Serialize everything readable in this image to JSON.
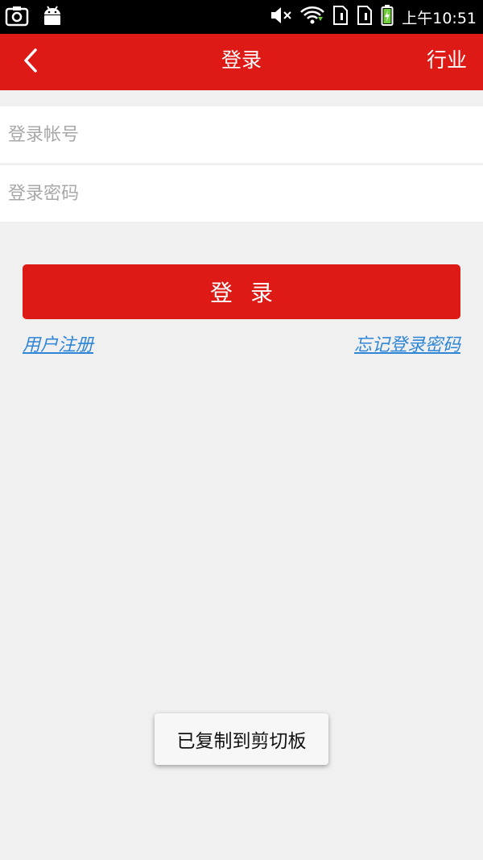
{
  "status_bar": {
    "time": "上午10:51",
    "left_icons": [
      "screenshot-icon",
      "android-icon"
    ],
    "right_icons": [
      "mute-icon",
      "wifi-icon",
      "sim1-icon",
      "sim2-icon",
      "battery-charging-icon"
    ]
  },
  "header": {
    "title": "登录",
    "action_label": "行业",
    "back_icon": "back-arrow-icon"
  },
  "form": {
    "account_placeholder": "登录帐号",
    "account_value": "",
    "password_placeholder": "登录密码",
    "password_value": "",
    "login_label": "登录",
    "register_link": "用户注册",
    "forgot_link": "忘记登录密码"
  },
  "toast": {
    "message": "已复制到剪切板"
  },
  "colors": {
    "brand": "#de1a16",
    "link": "#2f86d6",
    "background": "#f0f0f0"
  }
}
